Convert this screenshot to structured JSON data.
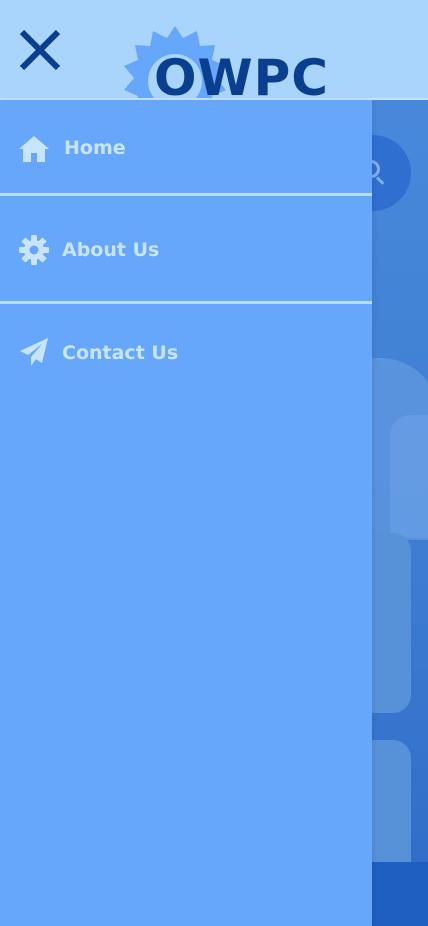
{
  "header": {
    "logo_text": "OWPC",
    "close_icon": "close-icon"
  },
  "drawer": {
    "items": [
      {
        "label": "Home",
        "icon": "home-icon"
      },
      {
        "label": "About Us",
        "icon": "gear-icon"
      },
      {
        "label": "Contact Us",
        "icon": "paper-plane-icon"
      }
    ]
  },
  "colors": {
    "header_bg": "#a9d4fb",
    "drawer_bg": "#66a7fc",
    "drawer_text": "#c9e4ff",
    "logo_text": "#0a3f8f",
    "close_icon": "#0a3f8f",
    "divider": "#b8dcfd"
  }
}
